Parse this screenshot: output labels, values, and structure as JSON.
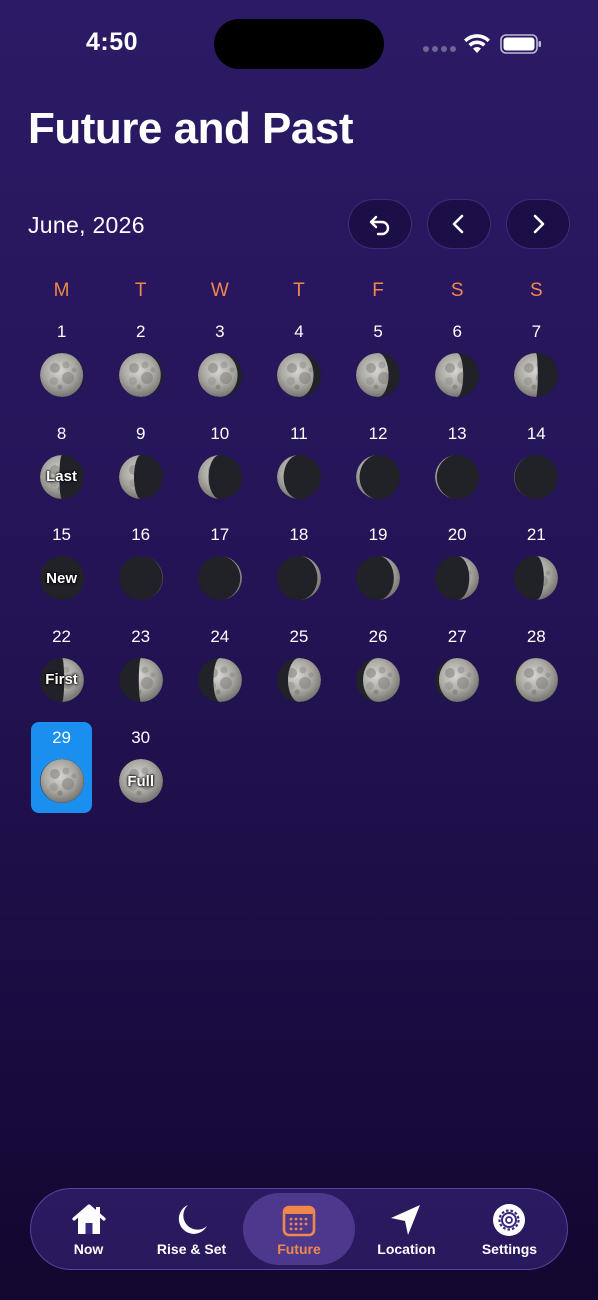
{
  "status": {
    "time": "4:50"
  },
  "title": "Future and Past",
  "month": "June, 2026",
  "weekdays": [
    "M",
    "T",
    "W",
    "T",
    "F",
    "S",
    "S"
  ],
  "weeks": [
    [
      {
        "day": "1",
        "lit": 0.98,
        "side": "left",
        "label": ""
      },
      {
        "day": "2",
        "lit": 0.95,
        "side": "left",
        "label": ""
      },
      {
        "day": "3",
        "lit": 0.9,
        "side": "left",
        "label": ""
      },
      {
        "day": "4",
        "lit": 0.83,
        "side": "left",
        "label": ""
      },
      {
        "day": "5",
        "lit": 0.74,
        "side": "left",
        "label": ""
      },
      {
        "day": "6",
        "lit": 0.64,
        "side": "left",
        "label": ""
      },
      {
        "day": "7",
        "lit": 0.54,
        "side": "left",
        "label": ""
      }
    ],
    [
      {
        "day": "8",
        "lit": 0.44,
        "side": "left",
        "label": "Last"
      },
      {
        "day": "9",
        "lit": 0.34,
        "side": "left",
        "label": ""
      },
      {
        "day": "10",
        "lit": 0.24,
        "side": "left",
        "label": ""
      },
      {
        "day": "11",
        "lit": 0.15,
        "side": "left",
        "label": ""
      },
      {
        "day": "12",
        "lit": 0.08,
        "side": "left",
        "label": ""
      },
      {
        "day": "13",
        "lit": 0.04,
        "side": "left",
        "label": ""
      },
      {
        "day": "14",
        "lit": 0.01,
        "side": "left",
        "label": ""
      }
    ],
    [
      {
        "day": "15",
        "lit": 0.0,
        "side": "right",
        "label": "New"
      },
      {
        "day": "16",
        "lit": 0.01,
        "side": "right",
        "label": ""
      },
      {
        "day": "17",
        "lit": 0.04,
        "side": "right",
        "label": ""
      },
      {
        "day": "18",
        "lit": 0.08,
        "side": "right",
        "label": ""
      },
      {
        "day": "19",
        "lit": 0.14,
        "side": "right",
        "label": ""
      },
      {
        "day": "20",
        "lit": 0.22,
        "side": "right",
        "label": ""
      },
      {
        "day": "21",
        "lit": 0.32,
        "side": "right",
        "label": ""
      }
    ],
    [
      {
        "day": "22",
        "lit": 0.45,
        "side": "right",
        "label": "First"
      },
      {
        "day": "23",
        "lit": 0.55,
        "side": "right",
        "label": ""
      },
      {
        "day": "24",
        "lit": 0.65,
        "side": "right",
        "label": ""
      },
      {
        "day": "25",
        "lit": 0.75,
        "side": "right",
        "label": ""
      },
      {
        "day": "26",
        "lit": 0.84,
        "side": "right",
        "label": ""
      },
      {
        "day": "27",
        "lit": 0.91,
        "side": "right",
        "label": ""
      },
      {
        "day": "28",
        "lit": 0.96,
        "side": "right",
        "label": ""
      }
    ],
    [
      {
        "day": "29",
        "lit": 0.99,
        "side": "right",
        "label": "",
        "selected": true
      },
      {
        "day": "30",
        "lit": 1.0,
        "side": "right",
        "label": "Full"
      }
    ]
  ],
  "tabs": [
    {
      "label": "Now",
      "icon": "house-icon",
      "active": false
    },
    {
      "label": "Rise & Set",
      "icon": "moon-icon",
      "active": false
    },
    {
      "label": "Future",
      "icon": "calendar-icon",
      "active": true
    },
    {
      "label": "Location",
      "icon": "location-arrow-icon",
      "active": false
    },
    {
      "label": "Settings",
      "icon": "gear-icon",
      "active": false
    }
  ],
  "colors": {
    "accent": "#f0884a",
    "selected": "#1a8ff0",
    "background_top": "#2c1a66",
    "background_bottom": "#12072e"
  }
}
